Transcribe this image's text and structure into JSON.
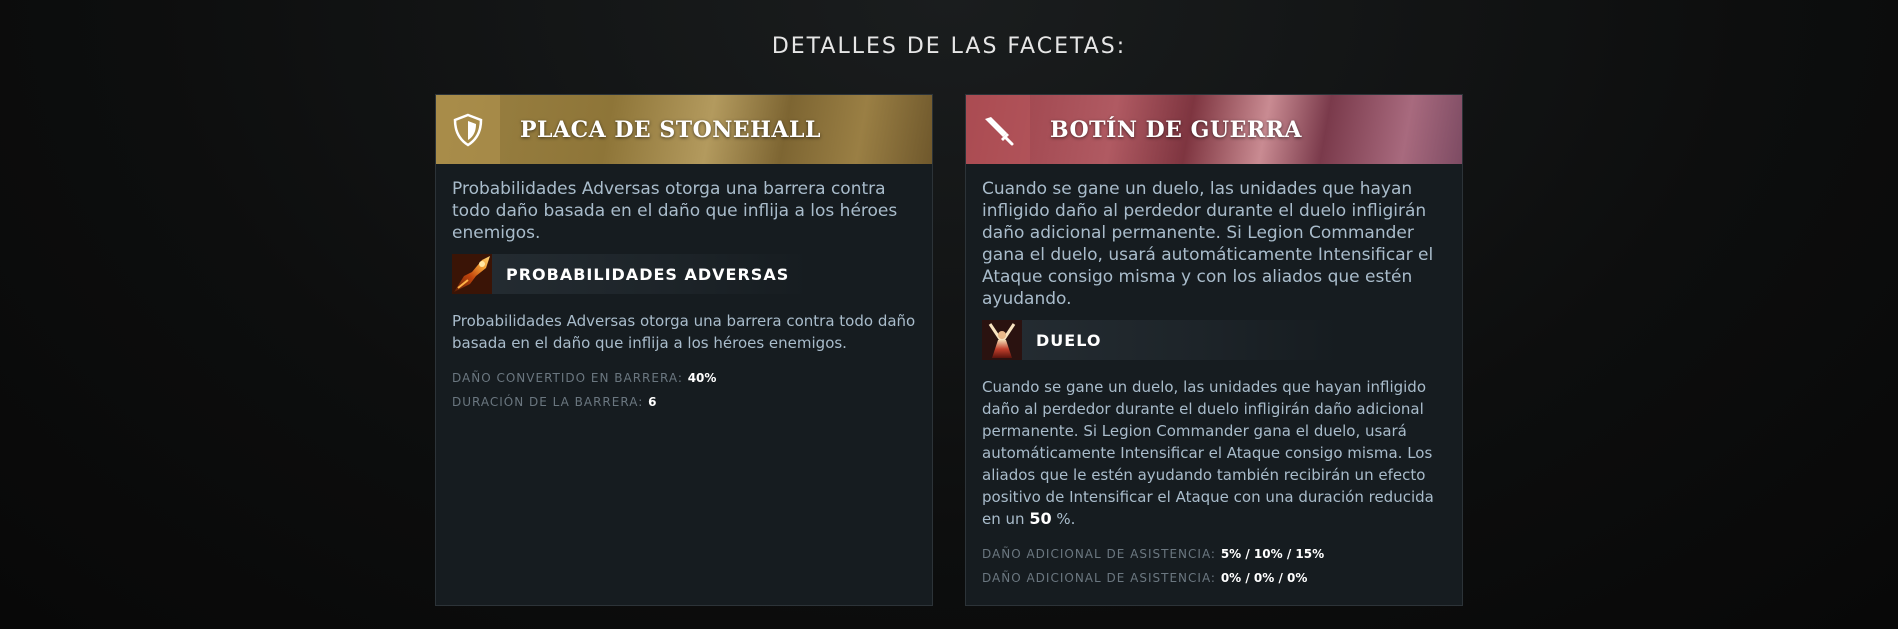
{
  "page": {
    "title": "DETALLES DE LAS FACETAS:"
  },
  "colors": {
    "left_accent": "#9a8142",
    "right_accent": "#9a3f47",
    "card_bg": "#161c20",
    "text_muted": "#a9bccb"
  },
  "facets": [
    {
      "icon": "shield-icon",
      "title": "PLACA DE STONEHALL",
      "description": "Probabilidades Adversas otorga una barrera contra todo daño basada en el daño que inflija a los héroes enemigos.",
      "ability": {
        "icon": "overwhelming-odds-ability-icon",
        "name": "PROBABILIDADES ADVERSAS",
        "description": "Probabilidades Adversas otorga una barrera contra todo daño basada en el daño que inflija a los héroes enemigos."
      },
      "stats": [
        {
          "label": "DAÑO CONVERTIDO EN BARRERA:",
          "value": "40%"
        },
        {
          "label": "DURACIÓN DE LA BARRERA:",
          "value": "6"
        }
      ]
    },
    {
      "icon": "sword-icon",
      "title": "BOTÍN DE GUERRA",
      "description": "Cuando se gane un duelo, las unidades que hayan infligido daño al perdedor durante el duelo infligirán daño adicional permanente. Si Legion Commander gana el duelo, usará automáticamente Intensificar el Ataque consigo misma y con los aliados que estén ayudando.",
      "ability": {
        "icon": "duel-ability-icon",
        "name": "DUELO",
        "description_before": "Cuando se gane un duelo, las unidades que hayan infligido daño al perdedor durante el duelo infligirán daño adicional permanente. Si Legion Commander gana el duelo, usará automáticamente Intensificar el Ataque consigo misma. Los aliados que le estén ayudando también recibirán un efecto positivo de Intensificar el Ataque con una duración reducida en un",
        "highlight": "50",
        "description_after": "%."
      },
      "stats": [
        {
          "label": "DAÑO ADICIONAL DE ASISTENCIA:",
          "value": "5% / 10% / 15%"
        },
        {
          "label": "DAÑO ADICIONAL DE ASISTENCIA:",
          "value": "0% / 0% / 0%"
        }
      ]
    }
  ]
}
